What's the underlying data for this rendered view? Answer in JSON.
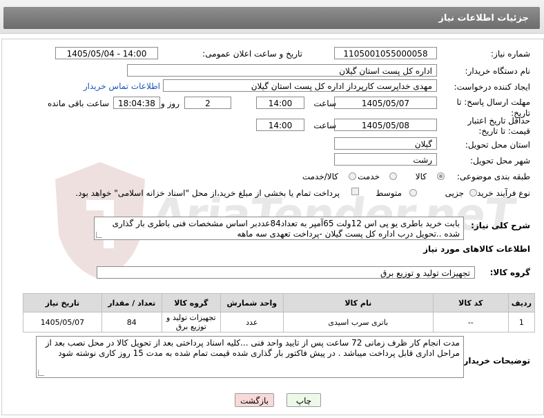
{
  "header": {
    "title": "جزئیات اطلاعات نیاز"
  },
  "watermark": {
    "text": "AriaTender.neT"
  },
  "form": {
    "need_number_label": "شماره نیاز:",
    "need_number": "1105001055000058",
    "announce_label": "تاریخ و ساعت اعلان عمومی:",
    "announce_value": "1405/05/04 - 14:00",
    "buyer_org_label": "نام دستگاه خریدار:",
    "buyer_org": "اداره کل پست استان گیلان",
    "creator_label": "ایجاد کننده درخواست:",
    "creator": "مهدی  خداپرست  کارپرداز  اداره کل پست استان گیلان",
    "contact_link": "اطلاعات تماس خریدار",
    "deadline_label": "مهلت ارسال پاسخ: تا تاریخ:",
    "deadline_date": "1405/05/07",
    "time_label": "ساعت",
    "deadline_time": "14:00",
    "days": "2",
    "days_label": "روز و",
    "remaining_time": "18:04:38",
    "remaining_label": "ساعت باقی مانده",
    "validity_label": "حداقل تاریخ اعتبار قیمت: تا تاریخ:",
    "validity_date": "1405/05/08",
    "validity_time_label": "ساعت",
    "validity_time": "14:00",
    "province_label": "استان محل تحویل:",
    "province": "گیلان",
    "city_label": "شهر محل تحویل:",
    "city": "رشت",
    "category_label": "طبقه بندی موضوعی:",
    "category_options": [
      "کالا",
      "خدمت",
      "کالا/خدمت"
    ],
    "process_label": "نوع فرآیند خرید :",
    "process_options": [
      "جزیی",
      "متوسط"
    ],
    "payment_note": "پرداخت تمام یا بخشی از مبلغ خرید،از محل \"اسناد خزانه اسلامی\" خواهد بود."
  },
  "description": {
    "label": "شرح کلی نیاز:",
    "text": "بابت خرید باطری یو پی اس 12ولت 65آمپر به تعداد84عددبر اساس مشخصات فنی باطری بار گذاری شده ..تحویل درب اداره کل پست گیلان -پرداخت تعهدی سه ماهه"
  },
  "goods_section": {
    "title": "اطلاعات کالاهای مورد نیاز"
  },
  "goods_group": {
    "label": "گروه کالا:",
    "value": "تجهیزات تولید و توزیع برق"
  },
  "table": {
    "headers": [
      "ردیف",
      "کد کالا",
      "نام کالا",
      "واحد شمارش",
      "گروه کالا",
      "تعداد / مقدار",
      "تاریخ نیاز"
    ],
    "rows": [
      [
        "1",
        "--",
        "باتری سرب اسیدی",
        "عدد",
        "تجهیزات تولید و توزیع برق",
        "84",
        "1405/05/07"
      ]
    ]
  },
  "buyer_notes": {
    "label": "توضیحات خریدار:",
    "text": "مدت انجام کار ظرف زمانی 72 ساعت پس از تایید واحد فنی ...کلیه اسناد پرداختی بعد از تحویل کالا در محل نصب بعد از مراحل اداری قابل پرداخت میباشد . در پیش فاکتور بار گذاری شده قیمت تمام شده به مدت 15 روز کاری نوشته شود"
  },
  "buttons": {
    "print": "چاپ",
    "back": "بازگشت"
  },
  "colors": {
    "header_bar": "#7a7a7a",
    "link": "#1a56b8",
    "back_button": "#f8d9d9",
    "print_button": "#eef8e8"
  }
}
